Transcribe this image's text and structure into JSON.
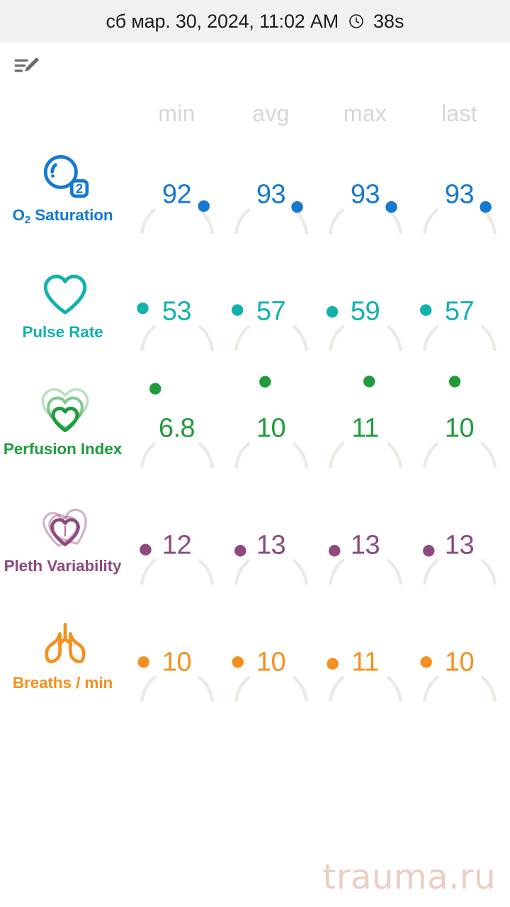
{
  "topbar": {
    "datetime": "сб мар. 30, 2024, 11:02 AM",
    "clock_icon": "clock-icon",
    "duration": "38s",
    "background": "#f1f1f1"
  },
  "toolbar": {
    "edit_note_icon": "edit-note-icon"
  },
  "table": {
    "columns": [
      "min",
      "avg",
      "max",
      "last"
    ],
    "column_color": "#d6d6d6",
    "track_color": "#eceae4"
  },
  "chart_data": {
    "type": "table",
    "title": "",
    "categories": [
      "min",
      "avg",
      "max",
      "last"
    ],
    "series": [
      {
        "name": "O₂ Saturation",
        "icon": "o2-saturation-icon",
        "color": "#1479d0",
        "values": [
          92,
          93,
          93,
          93
        ],
        "display": [
          "92",
          "93",
          "93",
          "93"
        ],
        "gauge_angles": [
          131,
          133,
          133,
          133
        ]
      },
      {
        "name": "Pulse Rate",
        "icon": "heart-outline-icon",
        "color": "#12b2ac",
        "values": [
          53,
          57,
          59,
          57
        ],
        "display": [
          "53",
          "57",
          "59",
          "57"
        ],
        "gauge_angles": [
          256,
          253,
          250,
          253
        ]
      },
      {
        "name": "Perfusion Index",
        "icon": "nested-hearts-icon",
        "color": "#1f9c3c",
        "values": [
          6.8,
          10,
          11,
          10
        ],
        "display": [
          "6.8",
          "10",
          "11",
          "10"
        ],
        "gauge_angles": [
          322,
          350,
          6,
          352
        ]
      },
      {
        "name": "Pleth Variability",
        "icon": "overlapping-hearts-icon",
        "color": "#8e4a7e",
        "values": [
          12,
          13,
          13,
          13
        ],
        "display": [
          "12",
          "13",
          "13",
          "13"
        ],
        "gauge_angles": [
          243,
          241,
          241,
          241
        ]
      },
      {
        "name": "Breaths / min",
        "icon": "lungs-icon",
        "color": "#f5901e",
        "values": [
          10,
          10,
          11,
          10
        ],
        "display": [
          "10",
          "10",
          "11",
          "10"
        ],
        "gauge_angles": [
          251,
          251,
          248,
          251
        ]
      }
    ]
  },
  "watermark": {
    "text": "trauma.ru",
    "color": "#eccdc2"
  }
}
